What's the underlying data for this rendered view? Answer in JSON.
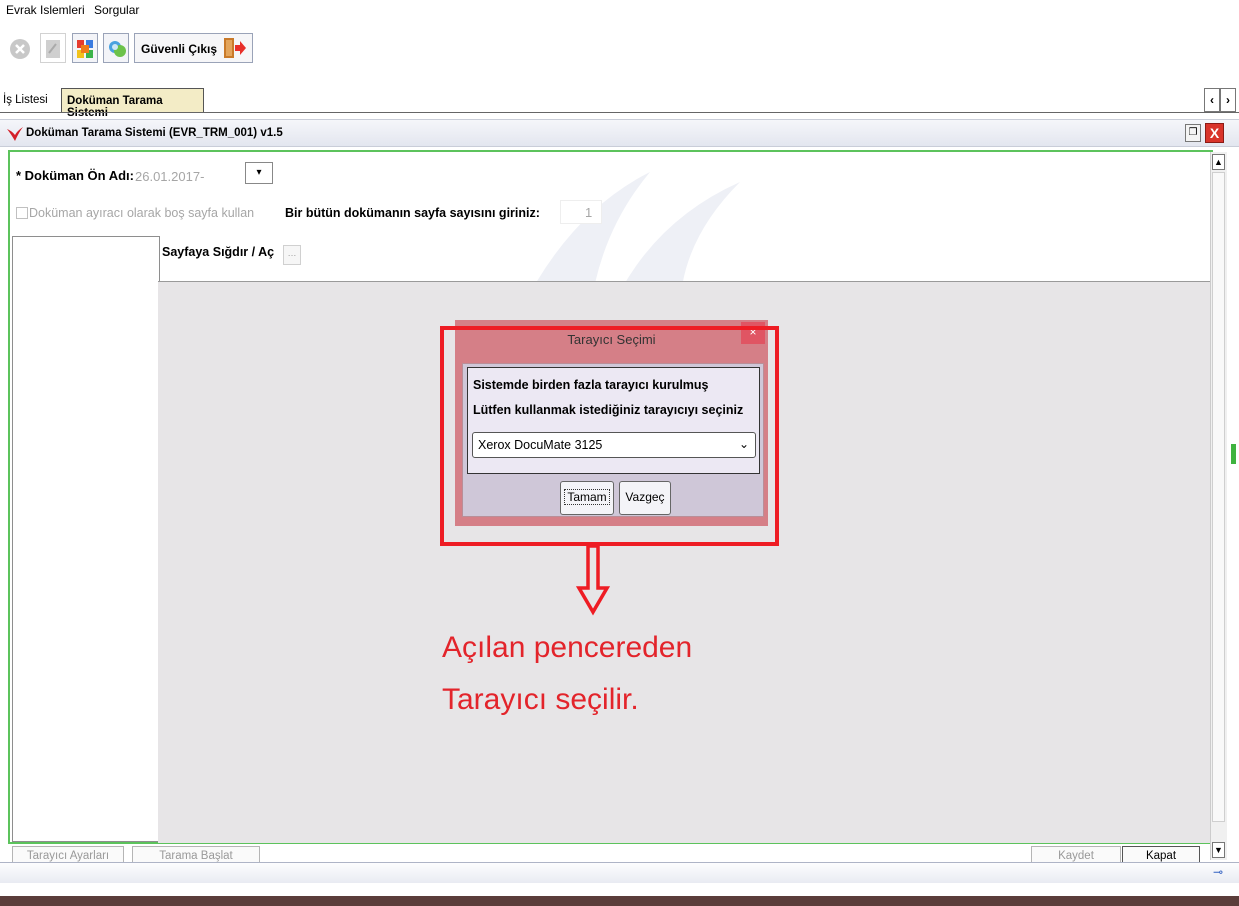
{
  "menu": {
    "items": [
      "Evrak Islemleri",
      "Sorgular"
    ]
  },
  "toolbar": {
    "secure_exit_label": "Güvenli Çıkış"
  },
  "tabs": [
    {
      "label": "İş Listesi",
      "active": false
    },
    {
      "label": "Doküman Tarama Sistemi",
      "active": true
    }
  ],
  "window": {
    "title": "Doküman Tarama Sistemi (EVR_TRM_001) v1.5"
  },
  "form": {
    "doc_prefix_label": "* Doküman Ön Adı:",
    "doc_prefix_value": "26.01.2017-",
    "blank_page_checkbox_label": "Doküman ayıracı olarak boş sayfa kullan",
    "page_count_label": "Bir bütün dokümanın sayfa sayısını giriniz:",
    "page_count_value": "1",
    "fit_page_label": "Sayfaya Sığdır / Aç"
  },
  "bottom_buttons": {
    "scanner_settings": "Tarayıcı Ayarları",
    "start_scan": "Tarama Başlat",
    "save": "Kaydet",
    "close": "Kapat"
  },
  "dialog": {
    "title": "Tarayıcı Seçimi",
    "close_symbol": "×",
    "message_line1": "Sistemde birden fazla tarayıcı kurulmuş",
    "message_line2": "Lütfen kullanmak istediğiniz tarayıcıyı seçiniz",
    "selected_scanner": "Xerox DocuMate 3125",
    "ok_label": "Tamam",
    "cancel_label": "Vazgeç"
  },
  "annotation": {
    "line1": "Açılan pencereden",
    "line2": "Tarayıcı seçilir.",
    "color": "#e3242b"
  },
  "colors": {
    "frame_green": "#5cc35c",
    "dialog_red": "#d57f87",
    "highlight_red": "#ee1c24"
  }
}
